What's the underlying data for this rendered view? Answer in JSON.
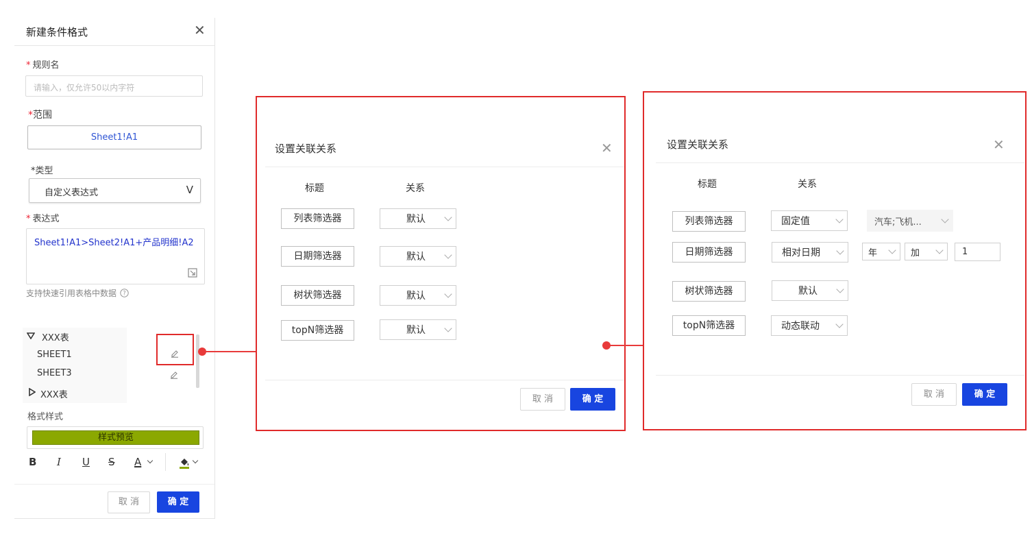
{
  "left_panel": {
    "title": "新建条件格式",
    "close": "✕",
    "rule_name_label": "规则名",
    "rule_name_placeholder": "请输入，仅允许50以内字符",
    "range_label": "范围",
    "range_value": "Sheet1!A1",
    "type_label": "类型",
    "type_value": "自定义表达式",
    "type_chevron": "V",
    "expr_label": "表达式",
    "expr_value": "Sheet1!A1>Sheet2!A1+产品明细!A2",
    "hint": "支持快速引用表格中数据",
    "tree": [
      {
        "label": "XXX表",
        "icon": "triangle-down-icon"
      },
      {
        "label": "SHEET1"
      },
      {
        "label": "SHEET3"
      },
      {
        "label": "XXX表",
        "icon": "triangle-right-icon"
      }
    ],
    "format_label": "格式样式",
    "preview_text": "样式预览",
    "toolbar": {
      "bold": "B",
      "italic": "I",
      "underline": "U",
      "strike": "S",
      "font_color": "A"
    },
    "cancel": "取 消",
    "ok": "确 定"
  },
  "dialog1": {
    "title": "设置关联关系",
    "close": "✕",
    "col_title": "标题",
    "col_relation": "关系",
    "rows": [
      {
        "label": "列表筛选器",
        "relation": "默认"
      },
      {
        "label": "日期筛选器",
        "relation": "默认"
      },
      {
        "label": "树状筛选器",
        "relation": "默认"
      },
      {
        "label": "topN筛选器",
        "relation": "默认"
      }
    ],
    "cancel": "取 消",
    "ok": "确 定"
  },
  "dialog2": {
    "title": "设置关联关系",
    "close": "✕",
    "col_title": "标题",
    "col_relation": "关系",
    "rows": [
      {
        "label": "列表筛选器",
        "relation": "固定值",
        "value": "汽车;飞机..."
      },
      {
        "label": "日期筛选器",
        "relation": "相对日期",
        "unit": "年",
        "op": "加",
        "num": "1"
      },
      {
        "label": "树状筛选器",
        "relation": "默认"
      },
      {
        "label": "topN筛选器",
        "relation": "动态联动"
      }
    ],
    "cancel": "取 消",
    "ok": "确 定"
  },
  "colors": {
    "accent": "#1845e0",
    "highlight": "#e02a2a",
    "preview_bg": "#8ba800",
    "link": "#2f55d4"
  }
}
